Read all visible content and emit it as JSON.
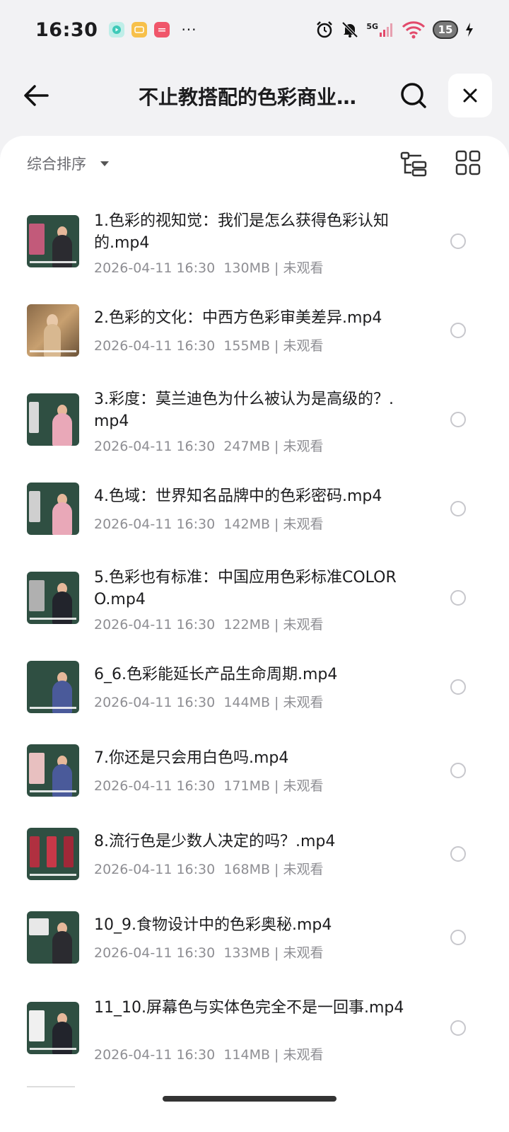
{
  "status_bar": {
    "time": "16:30",
    "notification_icons": [
      "video-app-icon",
      "bilibili-icon",
      "toutiao-icon"
    ],
    "more": "···",
    "network": "5G",
    "battery": "15"
  },
  "header": {
    "title": "不止教搭配的色彩商业…"
  },
  "toolbar": {
    "sort_label": "综合排序"
  },
  "files": [
    {
      "name": "1.色彩的视知觉：我们是怎么获得色彩认知的.mp4",
      "date": "2026-04-11 16:30",
      "size": "130MB",
      "status": "未观看"
    },
    {
      "name": "2.色彩的文化：中西方色彩审美差异.mp4",
      "date": "2026-04-11 16:30",
      "size": "155MB",
      "status": "未观看"
    },
    {
      "name": "3.彩度：莫兰迪色为什么被认为是高级的？.mp4",
      "date": "2026-04-11 16:30",
      "size": "247MB",
      "status": "未观看"
    },
    {
      "name": "4.色域：世界知名品牌中的色彩密码.mp4",
      "date": "2026-04-11 16:30",
      "size": "142MB",
      "status": "未观看"
    },
    {
      "name": "5.色彩也有标准：中国应用色彩标准COLORO.mp4",
      "date": "2026-04-11 16:30",
      "size": "122MB",
      "status": "未观看"
    },
    {
      "name": "6_6.色彩能延长产品生命周期.mp4",
      "date": "2026-04-11 16:30",
      "size": "144MB",
      "status": "未观看"
    },
    {
      "name": "7.你还是只会用白色吗.mp4",
      "date": "2026-04-11 16:30",
      "size": "171MB",
      "status": "未观看"
    },
    {
      "name": "8.流行色是少数人决定的吗？.mp4",
      "date": "2026-04-11 16:30",
      "size": "168MB",
      "status": "未观看"
    },
    {
      "name": "10_9.食物设计中的色彩奥秘.mp4",
      "date": "2026-04-11 16:30",
      "size": "133MB",
      "status": "未观看"
    },
    {
      "name": "11_10.屏幕色与实体色完全不是一回事.mp4",
      "date": "2026-04-11 16:30",
      "size": "114MB",
      "status": "未观看"
    }
  ],
  "colors": {
    "thumb_bg": "#2f4f42",
    "accent_text": "#1c1c1e",
    "muted_text": "#8e8e93"
  }
}
